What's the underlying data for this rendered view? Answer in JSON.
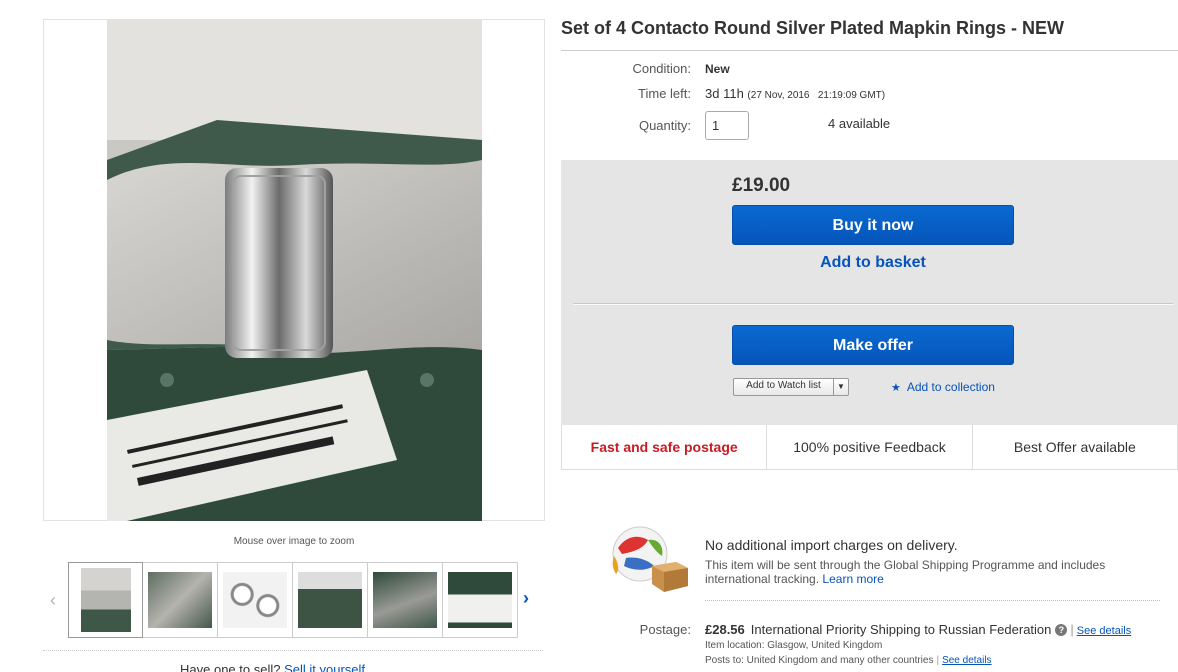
{
  "item": {
    "title": "Set of 4 Contacto Round Silver Plated Mapkin Rings - NEW",
    "condition_label": "Condition:",
    "condition_value": "New",
    "time_left_label": "Time left:",
    "time_left_value": "3d 11h",
    "time_left_end": "(27 Nov, 2016   21:19:09 GMT)",
    "quantity_label": "Quantity:",
    "quantity_value": "1",
    "available": "4 available"
  },
  "gallery": {
    "zoom_hint": "Mouse over image to zoom",
    "prev_icon": "chevron-left-icon",
    "next_icon": "chevron-right-icon",
    "thumbnail_count": 6
  },
  "buy_box": {
    "price": "£19.00",
    "buy_now_label": "Buy it now",
    "add_to_basket_label": "Add to basket",
    "make_offer_label": "Make offer",
    "watch_list_label": "Add to Watch list",
    "add_collection_label": "Add to collection",
    "accent_color": "#0654ba"
  },
  "badges": [
    {
      "label": "Fast and safe postage"
    },
    {
      "label": "100% positive Feedback"
    },
    {
      "label": "Best Offer available"
    }
  ],
  "shipping": {
    "gsp_title": "No additional import charges on delivery.",
    "gsp_text": "This item will be sent through the Global Shipping Programme and includes international tracking.",
    "learn_more": "Learn more",
    "postage_label": "Postage:",
    "postage_amount": "£28.56",
    "postage_service": "International Priority Shipping to Russian Federation",
    "see_details": "See details",
    "item_location": "Item location:  Glasgow, United Kingdom",
    "posts_to": "Posts to:  United Kingdom and many other countries",
    "see_details_2": "See details"
  },
  "seller_row": {
    "text": "Have one to sell?",
    "link": "Sell it yourself"
  }
}
